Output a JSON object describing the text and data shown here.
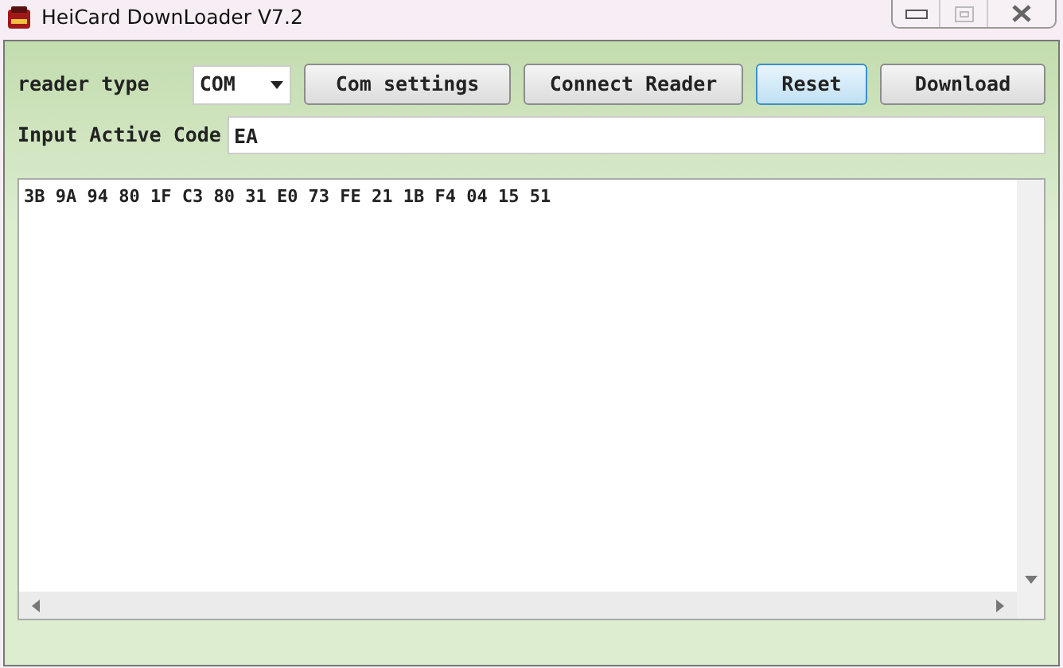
{
  "window": {
    "title": "HeiCard DownLoader V7.2"
  },
  "reader_type": {
    "label": "reader type",
    "value": "COM"
  },
  "buttons": [
    {
      "label": "Com settings",
      "focused": false
    },
    {
      "label": "Connect Reader",
      "focused": false
    },
    {
      "label": "Reset",
      "focused": true
    },
    {
      "label": "Download",
      "focused": false
    }
  ],
  "active_code": {
    "label": "Input Active Code",
    "value": "EA"
  },
  "output": {
    "lines": [
      "3B 9A 94 80 1F C3 80 31 E0 73 FE 21 1B F4 04 15 51"
    ]
  }
}
